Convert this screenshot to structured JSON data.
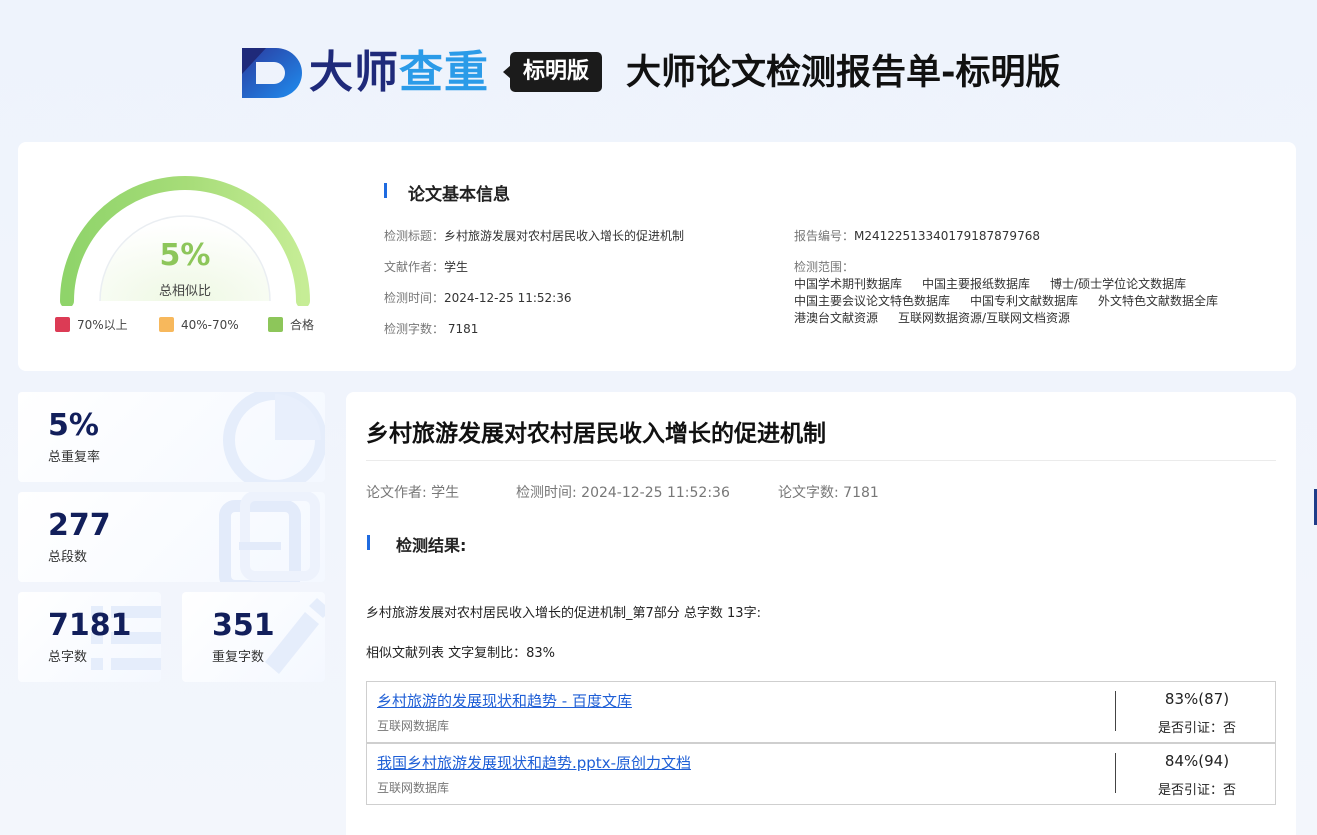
{
  "header": {
    "brand_part1": "大师",
    "brand_part2": "查重",
    "edition_badge": "标明版",
    "report_title": "大师论文检测报告单-标明版"
  },
  "summary": {
    "similarity_percent": "5%",
    "similarity_value": 5,
    "similarity_label": "总相似比",
    "legend": [
      {
        "label": "70%以上",
        "color": "#dc3b55"
      },
      {
        "label": "40%-70%",
        "color": "#f7b85c"
      },
      {
        "label": "合格",
        "color": "#8dc65a"
      }
    ]
  },
  "basic_info": {
    "section_title": "论文基本信息",
    "title_key": "检测标题：",
    "title_value": "乡村旅游发展对农村居民收入增长的促进机制",
    "author_key": "文献作者：",
    "author_value": "学生",
    "time_key": "检测时间：",
    "time_value": "2024-12-25 11:52:36",
    "words_key": "检测字数：",
    "words_value": "7181",
    "report_no_key": "报告编号：",
    "report_no_value": "M241225133401791878797​68",
    "scope_key": "检测范围：",
    "scope_line1": [
      "中国学术期刊数据库",
      "中国主要报纸数据库",
      "博士/硕士学位论文数据库"
    ],
    "scope_line2": [
      "中国主要会议论文特色数据库",
      "中国专利文献数据库",
      "外文特色文献数据全库"
    ],
    "scope_line3": [
      "港澳台文献资源",
      "互联网数据资源/互联网文档资源"
    ]
  },
  "stats": [
    {
      "value": "5%",
      "label": "总重复率"
    },
    {
      "value": "277",
      "label": "总段数"
    },
    {
      "value": "7181",
      "label": "总字数"
    },
    {
      "value": "351",
      "label": "重复字数"
    }
  ],
  "report": {
    "doc_title": "乡村旅游发展对农村居民收入增长的促进机制",
    "meta_author": "论文作者: 学生",
    "meta_time": "检测时间: 2024-12-25 11:52:36",
    "meta_words": "论文字数: 7181",
    "result_title": "检测结果:",
    "part_line": "乡村旅游发展对农村居民收入增长的促进机制_第7部分 总字数 13字:",
    "sim_line": "相似文献列表 文字复制比：83%",
    "sources": [
      {
        "title": "乡村旅游的发展现状和趋势 - 百度文库",
        "db": "互联网数据库",
        "percent": "83%(87)",
        "cite": "是否引证：否"
      },
      {
        "title": "我国乡村旅游发展现状和趋势.pptx-原创力文档",
        "db": "互联网数据库",
        "percent": "84%(94)",
        "cite": "是否引证：否"
      }
    ]
  }
}
